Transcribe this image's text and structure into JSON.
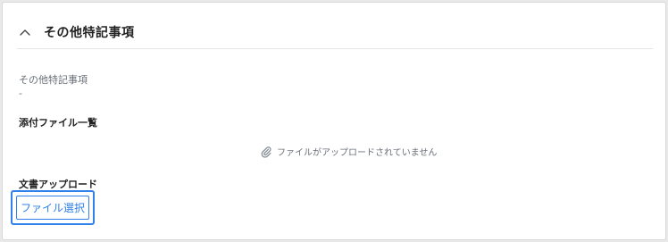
{
  "section": {
    "title": "その他特記事項",
    "expanded": true,
    "toggle_icon": "chevron-up-icon"
  },
  "field": {
    "label": "その他特記事項",
    "value": "-"
  },
  "attachments": {
    "heading": "添付ファイル一覧",
    "empty_message": "ファイルがアップロードされていません",
    "icon": "paperclip-icon"
  },
  "upload": {
    "heading": "文書アップロード",
    "button_label": "ファイル選択",
    "focused": true
  },
  "colors": {
    "accent": "#2f80e8",
    "muted_text": "#6a6f78",
    "heading_text": "#222222",
    "card_border": "#d9d9d9"
  }
}
